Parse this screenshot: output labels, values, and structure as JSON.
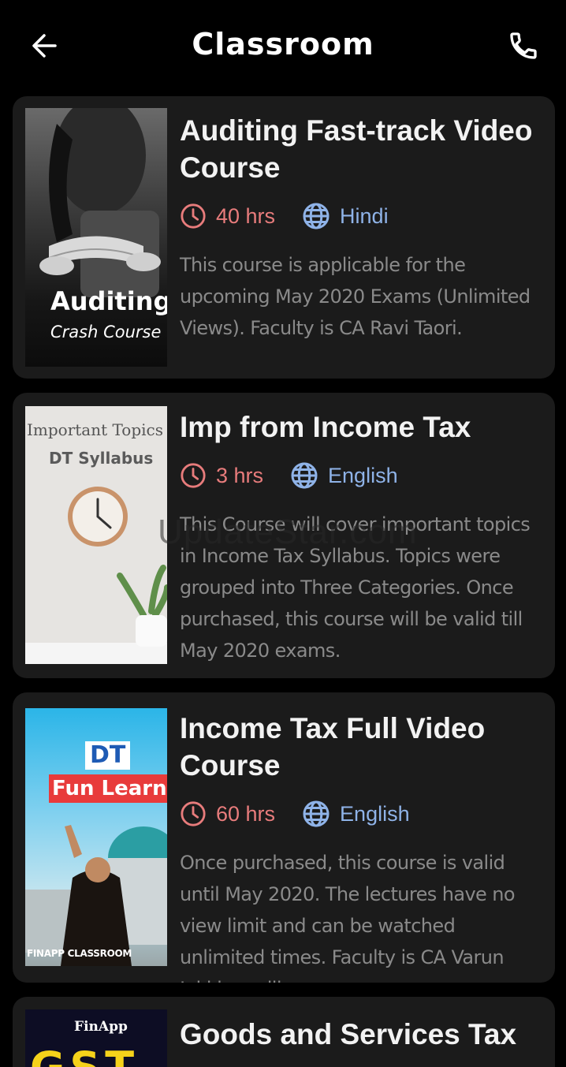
{
  "header": {
    "title": "Classroom"
  },
  "courses": [
    {
      "title": "Auditing Fast-track Video Course",
      "duration": "40 hrs",
      "language": "Hindi",
      "description": "This course is applicable for the upcoming May 2020 Exams (Unlimited Views). Faculty is CA Ravi Taori.",
      "thumb": {
        "title": "Auditing",
        "subtitle": "Crash Course"
      }
    },
    {
      "title": "Imp from Income Tax",
      "duration": "3 hrs",
      "language": "English",
      "description": "This Course will cover important topics in Income Tax Syllabus. Topics were grouped into Three Categories. Once purchased, this course will be valid till May 2020 exams.",
      "thumb": {
        "title": "Important Topics",
        "subtitle": "DT Syllabus"
      }
    },
    {
      "title": "Income Tax Full Video Course",
      "duration": "60 hrs",
      "language": "English",
      "description": "Once purchased, this course is valid until May 2020. The lectures have no view limit and can be watched unlimited times. Faculty is CA Varun Jakkinapalli.",
      "thumb": {
        "title": "DT",
        "subtitle": "Fun Learn",
        "brand": "FINAPP CLASSROOM"
      }
    },
    {
      "title": "Goods and Services Tax",
      "thumb": {
        "title": "FinApp",
        "subtitle": "GST"
      }
    }
  ],
  "watermark": "UpdateStar.com",
  "colors": {
    "duration": "#e87c7c",
    "language": "#8fb3e8",
    "card_bg": "#1b1b1b"
  }
}
